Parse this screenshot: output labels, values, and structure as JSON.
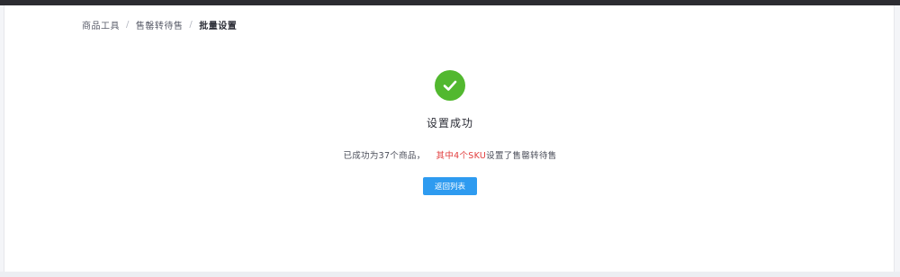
{
  "breadcrumb": {
    "items": [
      "商品工具",
      "售罄转待售",
      "批量设置"
    ],
    "separator": "/"
  },
  "result": {
    "icon": "check-circle-icon",
    "title": "设置成功",
    "message_prefix": "已成功为37个商品，",
    "message_highlight": "其中4个SKU",
    "message_suffix": "设置了售罄转待售"
  },
  "actions": {
    "back_label": "返回列表"
  },
  "colors": {
    "success": "#52b82f",
    "primary": "#2e9bf0",
    "highlight": "#e23d3d"
  }
}
